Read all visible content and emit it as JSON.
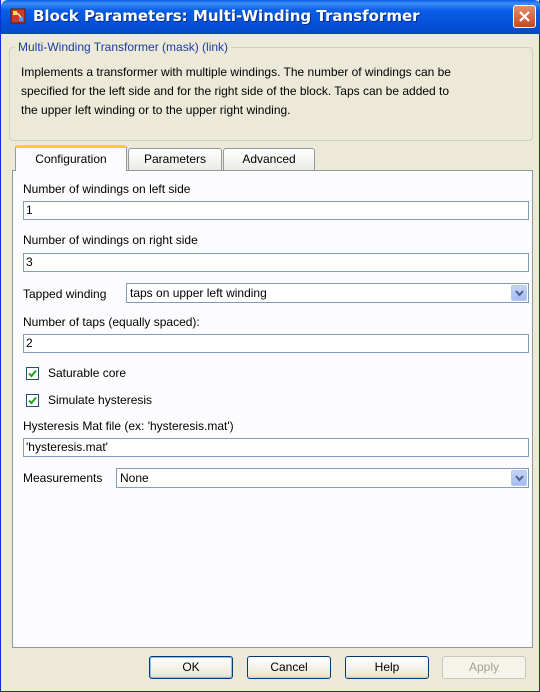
{
  "window": {
    "title": "Block Parameters: Multi-Winding Transformer"
  },
  "group": {
    "legend": "Multi-Winding Transformer (mask) (link)",
    "description_lines": [
      "Implements a transformer with multiple windings. The number of windings can be",
      "specified for the left side and for the right side of the block. Taps can be added to",
      "the upper left winding or to the upper right winding."
    ]
  },
  "tabs": [
    {
      "label": "Configuration",
      "active": true
    },
    {
      "label": "Parameters",
      "active": false
    },
    {
      "label": "Advanced",
      "active": false
    }
  ],
  "form": {
    "left_windings": {
      "label": "Number of windings on left side",
      "value": "1"
    },
    "right_windings": {
      "label": "Number of windings on right side",
      "value": "3"
    },
    "tapped_winding": {
      "label": "Tapped winding",
      "value": "taps on upper left winding"
    },
    "num_taps": {
      "label": "Number of taps (equally spaced):",
      "value": "2"
    },
    "saturable_core": {
      "label": "Saturable core",
      "checked": true
    },
    "simulate_hysteresis": {
      "label": "Simulate hysteresis",
      "checked": true
    },
    "hysteresis_file": {
      "label": "Hysteresis Mat file (ex: 'hysteresis.mat')",
      "value": "'hysteresis.mat'"
    },
    "measurements": {
      "label": "Measurements",
      "value": "None"
    }
  },
  "buttons": {
    "ok": "OK",
    "cancel": "Cancel",
    "help": "Help",
    "apply": "Apply"
  },
  "colors": {
    "titlebar": "#0a5fe8",
    "dialog_bg": "#ece9d8",
    "legend_text": "#1c3ba0",
    "tab_highlight": "#ffc83c",
    "check_mark": "#21a121"
  },
  "icons": {
    "app": "simulink-block-icon",
    "close": "close-x-icon",
    "dropdown": "chevron-down-icon",
    "check": "checkmark-icon"
  }
}
